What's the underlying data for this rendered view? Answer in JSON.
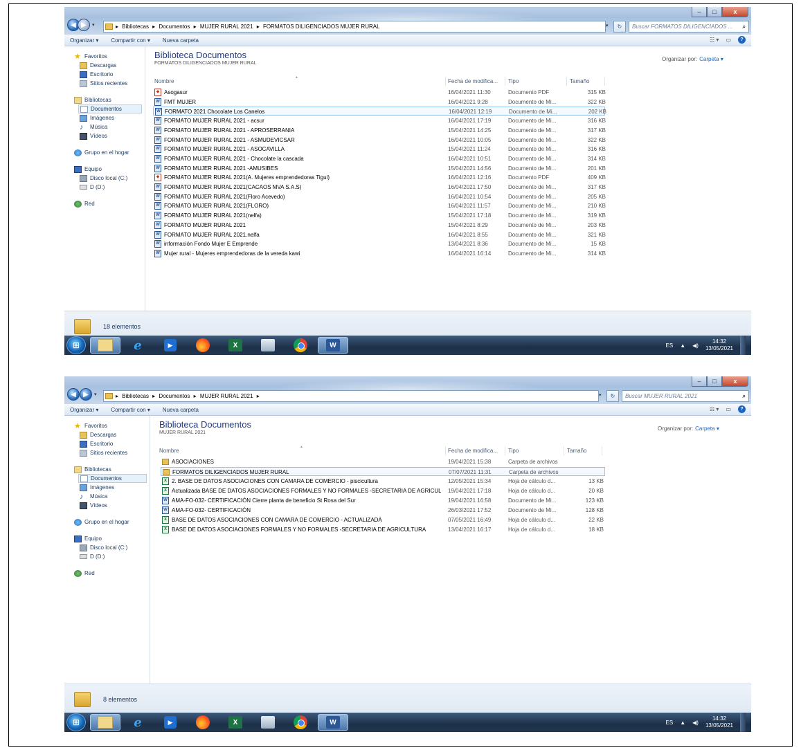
{
  "screens": [
    {
      "title_buttons": {
        "minimize": "–",
        "maximize": "□",
        "close": "x"
      },
      "breadcrumb": [
        "Bibliotecas",
        "Documentos",
        "MUJER RURAL 2021",
        "FORMATOS DILIGENCIADOS MUJER RURAL"
      ],
      "search_placeholder": "Buscar FORMATOS DILIGENCIADOS ...",
      "toolbar": {
        "organize": "Organizar ▾",
        "share": "Compartir con ▾",
        "new_folder": "Nueva carpeta"
      },
      "sidebar": {
        "favorites": {
          "label": "Favoritos",
          "items": [
            "Descargas",
            "Escritorio",
            "Sitios recientes"
          ]
        },
        "libraries": {
          "label": "Bibliotecas",
          "items": [
            "Documentos",
            "Imágenes",
            "Música",
            "Vídeos"
          ]
        },
        "homegroup": "Grupo en el hogar",
        "computer": {
          "label": "Equipo",
          "items": [
            "Disco local (C:)",
            "D (D:)"
          ]
        },
        "network": "Red"
      },
      "library_title": "Biblioteca Documentos",
      "library_subtitle": "FORMATOS DILIGENCIADOS MUJER RURAL",
      "arrange_label": "Organizar por:",
      "arrange_value": "Carpeta ▾",
      "columns": [
        "Nombre",
        "Fecha de modifica...",
        "Tipo",
        "Tamaño"
      ],
      "files": [
        {
          "icon": "pdf",
          "name": "Asogasur",
          "date": "16/04/2021 11:30",
          "type": "Documento PDF",
          "size": "315 KB"
        },
        {
          "icon": "word",
          "name": "FMT MUJER",
          "date": "16/04/2021 9:28",
          "type": "Documento de Mi...",
          "size": "322 KB"
        },
        {
          "icon": "word",
          "name": "FORMATO 2021 Chocolate Los Canelos",
          "date": "16/04/2021 12:19",
          "type": "Documento de Mi...",
          "size": "202 KB",
          "selected": true
        },
        {
          "icon": "word",
          "name": "FORMATO MUJER RURAL 2021 - acsur",
          "date": "16/04/2021 17:19",
          "type": "Documento de Mi...",
          "size": "316 KB"
        },
        {
          "icon": "word",
          "name": "FORMATO MUJER RURAL 2021 - APROSERRANIA",
          "date": "15/04/2021 14:25",
          "type": "Documento de Mi...",
          "size": "317 KB"
        },
        {
          "icon": "word",
          "name": "FORMATO MUJER RURAL 2021 - ASMUDEVICSAR",
          "date": "16/04/2021 10:05",
          "type": "Documento de Mi...",
          "size": "322 KB"
        },
        {
          "icon": "word",
          "name": "FORMATO MUJER RURAL 2021 - ASOCAVILLA",
          "date": "15/04/2021 11:24",
          "type": "Documento de Mi...",
          "size": "316 KB"
        },
        {
          "icon": "word",
          "name": "FORMATO MUJER RURAL 2021 - Chocolate la cascada",
          "date": "16/04/2021 10:51",
          "type": "Documento de Mi...",
          "size": "314 KB"
        },
        {
          "icon": "word",
          "name": "FORMATO MUJER RURAL 2021 -AMUSIBES",
          "date": "15/04/2021 14:56",
          "type": "Documento de Mi...",
          "size": "201 KB"
        },
        {
          "icon": "pdf",
          "name": "FORMATO MUJER RURAL 2021(A. Mujeres emprendedoras Tigui)",
          "date": "16/04/2021 12:16",
          "type": "Documento PDF",
          "size": "409 KB"
        },
        {
          "icon": "word",
          "name": "FORMATO MUJER RURAL 2021(CACAOS MVA S.A.S)",
          "date": "16/04/2021 17:50",
          "type": "Documento de Mi...",
          "size": "317 KB"
        },
        {
          "icon": "word",
          "name": "FORMATO MUJER RURAL 2021(Floro Acevedo)",
          "date": "16/04/2021 10:54",
          "type": "Documento de Mi...",
          "size": "205 KB"
        },
        {
          "icon": "word",
          "name": "FORMATO MUJER RURAL 2021(FLORO)",
          "date": "16/04/2021 11:57",
          "type": "Documento de Mi...",
          "size": "210 KB"
        },
        {
          "icon": "word",
          "name": "FORMATO MUJER RURAL 2021(nelfa)",
          "date": "15/04/2021 17:18",
          "type": "Documento de Mi...",
          "size": "319 KB"
        },
        {
          "icon": "word",
          "name": "FORMATO MUJER RURAL 2021",
          "date": "15/04/2021 8:29",
          "type": "Documento de Mi...",
          "size": "203 KB"
        },
        {
          "icon": "word",
          "name": "FORMATO MUJER RURAL 2021.nelfa",
          "date": "16/04/2021 8:55",
          "type": "Documento de Mi...",
          "size": "321 KB"
        },
        {
          "icon": "word",
          "name": "información Fondo Mujer E Emprende",
          "date": "13/04/2021 8:36",
          "type": "Documento de Mi...",
          "size": "15 KB"
        },
        {
          "icon": "word",
          "name": "Mujer rural - Mujeres emprendedoras de la  vereda kawi",
          "date": "16/04/2021 16:14",
          "type": "Documento de Mi...",
          "size": "314 KB"
        }
      ],
      "status": "18 elementos",
      "tray": {
        "lang": "ES",
        "arrow": "▲",
        "volume": "◀)",
        "time": "14:32",
        "date": "13/05/2021"
      }
    },
    {
      "title_buttons": {
        "minimize": "–",
        "maximize": "□",
        "close": "x"
      },
      "breadcrumb": [
        "Bibliotecas",
        "Documentos",
        "MUJER RURAL 2021"
      ],
      "search_placeholder": "Buscar MUJER RURAL 2021",
      "toolbar": {
        "organize": "Organizar ▾",
        "share": "Compartir con ▾",
        "new_folder": "Nueva carpeta"
      },
      "sidebar": {
        "favorites": {
          "label": "Favoritos",
          "items": [
            "Descargas",
            "Escritorio",
            "Sitios recientes"
          ]
        },
        "libraries": {
          "label": "Bibliotecas",
          "items": [
            "Documentos",
            "Imágenes",
            "Música",
            "Vídeos"
          ]
        },
        "homegroup": "Grupo en el hogar",
        "computer": {
          "label": "Equipo",
          "items": [
            "Disco local (C:)",
            "D (D:)"
          ]
        },
        "network": "Red"
      },
      "library_title": "Biblioteca Documentos",
      "library_subtitle": "MUJER RURAL 2021",
      "arrange_label": "Organizar por:",
      "arrange_value": "Carpeta ▾",
      "columns": [
        "Nombre",
        "Fecha de modifica...",
        "Tipo",
        "Tamaño"
      ],
      "files": [
        {
          "icon": "folder",
          "name": "ASOCIACIONES",
          "date": "19/04/2021 15:38",
          "type": "Carpeta de archivos",
          "size": ""
        },
        {
          "icon": "folder",
          "name": "FORMATOS DILIGENCIADOS MUJER RURAL",
          "date": "07/07/2021 11:31",
          "type": "Carpeta de archivos",
          "size": "",
          "selected": true
        },
        {
          "icon": "xls",
          "name": "2. BASE DE DATOS ASOCIACIONES CON CAMARA DE COMERCIO - piscicultura",
          "date": "12/05/2021 15:34",
          "type": "Hoja de cálculo d...",
          "size": "13 KB"
        },
        {
          "icon": "xls",
          "name": "Actualizada BASE DE DATOS ASOCIACIONES FORMALES Y NO FORMALES -SECRETARIA DE AGRICUL...",
          "date": "19/04/2021 17:18",
          "type": "Hoja de cálculo d...",
          "size": "20 KB"
        },
        {
          "icon": "word",
          "name": "AMA-FO-032- CERTIFICACIÓN Cierre planta de beneficio St Rosa del Sur",
          "date": "19/04/2021 16:58",
          "type": "Documento de Mi...",
          "size": "123 KB"
        },
        {
          "icon": "word",
          "name": "AMA-FO-032- CERTIFICACIÓN",
          "date": "26/03/2021 17:52",
          "type": "Documento de Mi...",
          "size": "128 KB"
        },
        {
          "icon": "xls",
          "name": "BASE DE DATOS ASOCIACIONES CON CAMARA DE COMERCIO - ACTUALIZADA",
          "date": "07/05/2021 16:49",
          "type": "Hoja de cálculo d...",
          "size": "22 KB"
        },
        {
          "icon": "xls",
          "name": "BASE DE DATOS ASOCIACIONES FORMALES Y NO FORMALES -SECRETARIA DE AGRICULTURA",
          "date": "13/04/2021 16:17",
          "type": "Hoja de cálculo d...",
          "size": "18 KB"
        }
      ],
      "status": "8 elementos",
      "tray": {
        "lang": "ES",
        "arrow": "▲",
        "volume": "◀)",
        "time": "14:32",
        "date": "13/05/2021"
      }
    }
  ]
}
